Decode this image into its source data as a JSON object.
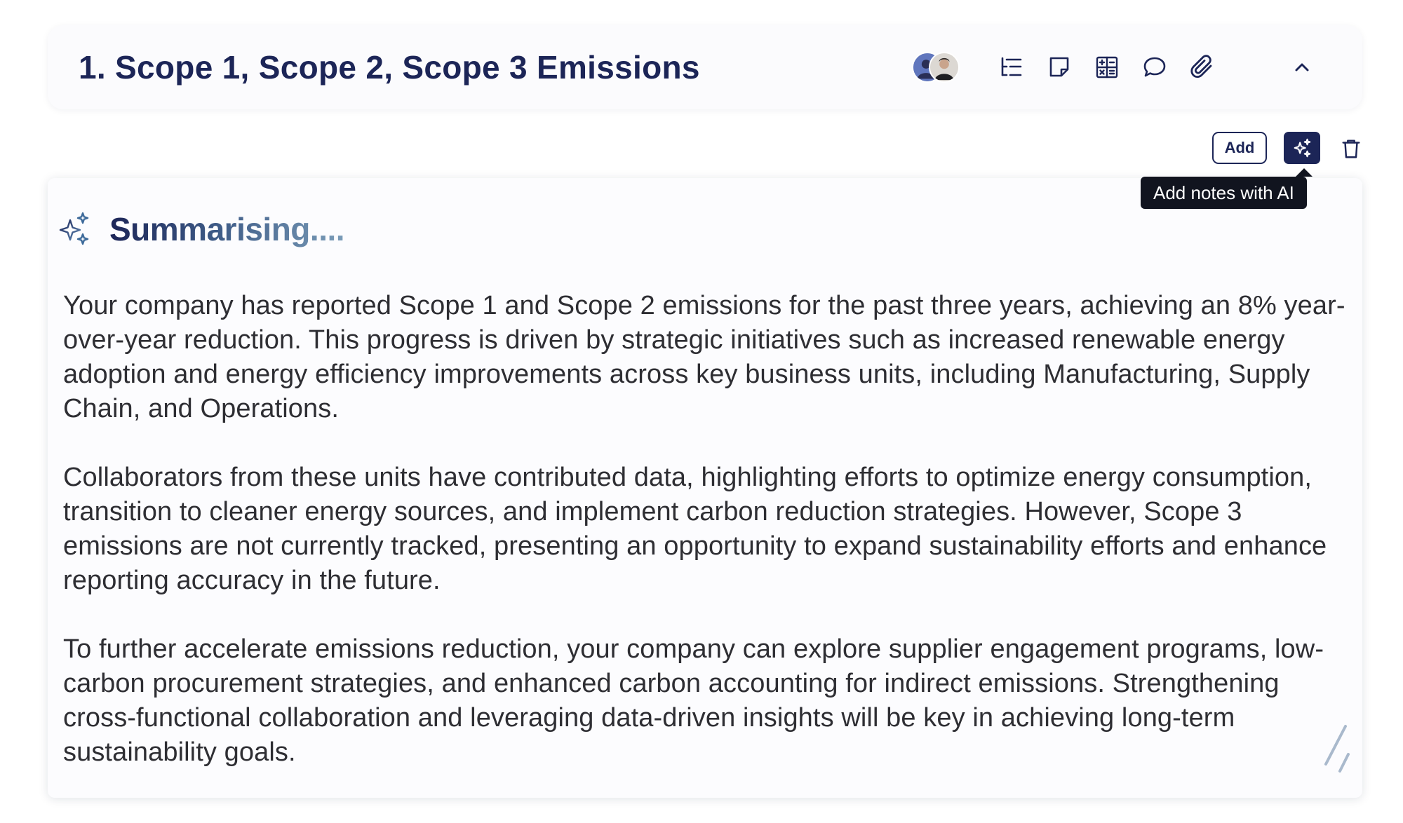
{
  "section": {
    "title": "1. Scope 1, Scope 2, Scope 3 Emissions"
  },
  "header_tools": [
    {
      "name": "outline-icon"
    },
    {
      "name": "sticky-note-icon"
    },
    {
      "name": "calculator-icon"
    },
    {
      "name": "comment-icon"
    },
    {
      "name": "paperclip-icon"
    }
  ],
  "actions": {
    "add_label": "Add",
    "ai_tooltip": "Add notes with AI"
  },
  "summary": {
    "heading": "Summarising....",
    "paragraphs": [
      "Your company has reported Scope 1 and Scope 2 emissions for the past three years, achieving an 8% year-over-year reduction. This progress is driven by strategic initiatives such as increased renewable energy adoption and energy efficiency improvements across key business units, including Manufacturing, Supply Chain, and Operations.",
      "Collaborators from these units have contributed data, highlighting efforts to optimize energy consumption, transition to cleaner energy sources, and implement carbon reduction strategies. However, Scope 3 emissions are not currently tracked, presenting an opportunity to expand sustainability efforts and enhance reporting accuracy in the future.",
      "To further accelerate emissions reduction, your company can explore supplier engagement programs, low-carbon procurement strategies, and enhanced carbon accounting for indirect emissions. Strengthening cross-functional collaboration and leveraging data-driven insights will be key in achieving long-term sustainability goals."
    ]
  },
  "colors": {
    "navy": "#1c2557",
    "text": "#2e2e33",
    "tooltip_bg": "#11141f",
    "sparkle_accent": "#3d6a9a"
  }
}
